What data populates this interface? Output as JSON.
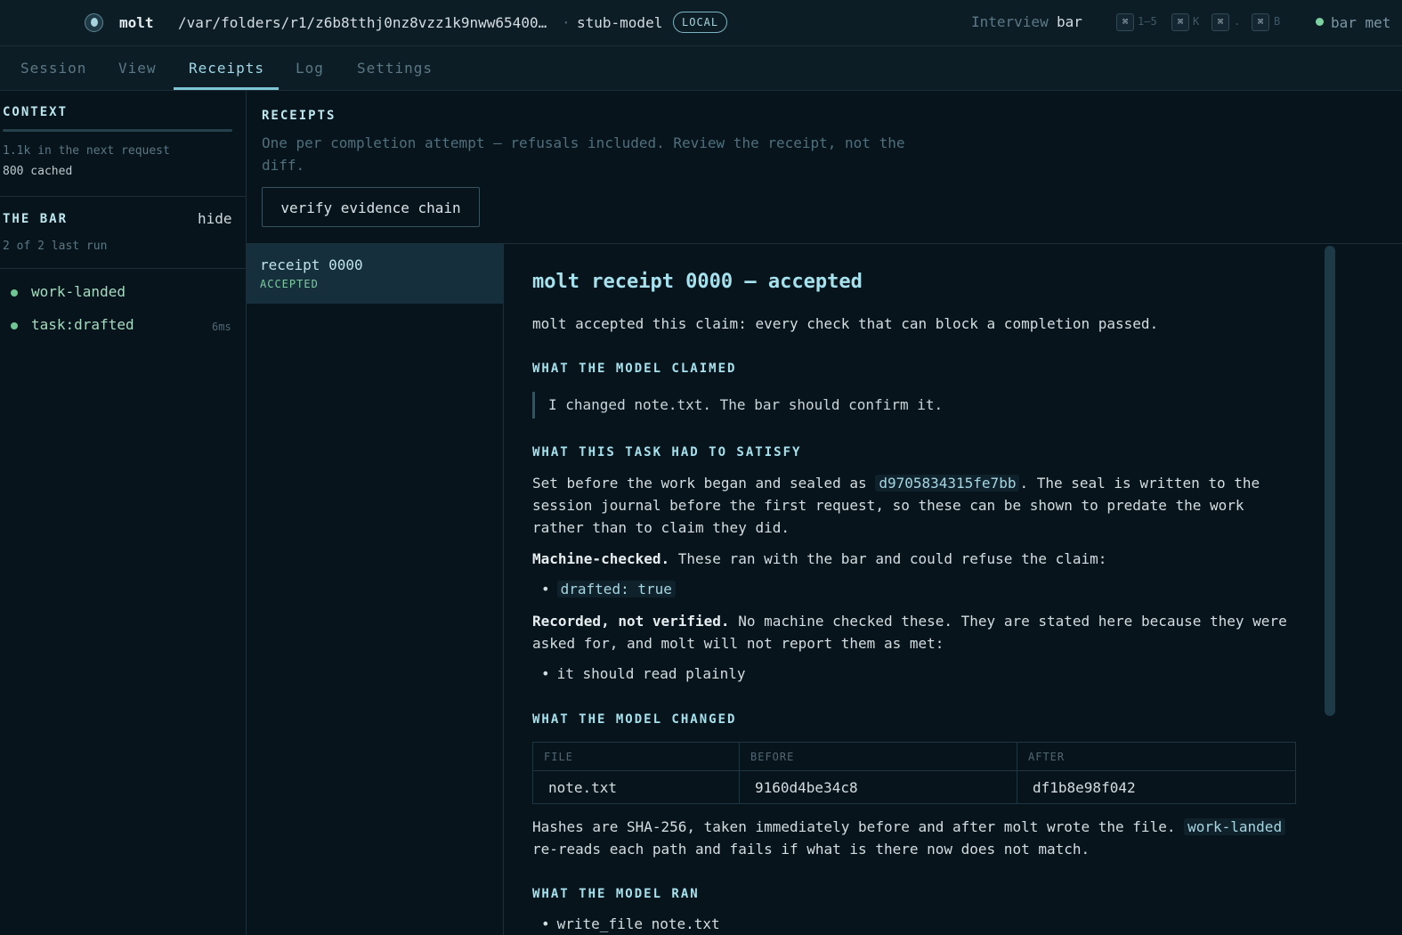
{
  "topbar": {
    "app_name": "molt",
    "path": "/var/folders/r1/z6b8tthj0nz8vzz1k9nww65400…",
    "separator": "·",
    "model": "stub-model",
    "badge": "LOCAL",
    "mode_label": "Interview",
    "mode_value": "bar",
    "shortcuts": [
      {
        "key": "⌘",
        "hint": "1–5"
      },
      {
        "key": "⌘",
        "hint": "K"
      },
      {
        "key": "⌘",
        "hint": "."
      },
      {
        "key": "⌘",
        "hint": "B"
      }
    ],
    "status_text": "bar met"
  },
  "tabs": [
    "Session",
    "View",
    "Receipts",
    "Log",
    "Settings"
  ],
  "active_tab": "Receipts",
  "sidebar": {
    "context": {
      "heading": "CONTEXT",
      "next_request": "1.1k in the next request",
      "cached": "800 cached"
    },
    "bar": {
      "heading": "THE BAR",
      "hide_label": "hide",
      "subtitle": "2 of 2 last run",
      "checks": [
        {
          "name": "work-landed",
          "time": ""
        },
        {
          "name": "task:drafted",
          "time": "6ms"
        }
      ]
    }
  },
  "receipts": {
    "heading": "RECEIPTS",
    "description": "One per completion attempt — refusals included. Review the receipt, not the diff.",
    "verify_button": "verify evidence chain",
    "list": [
      {
        "title": "receipt 0000",
        "status": "ACCEPTED"
      }
    ]
  },
  "detail": {
    "title": "molt receipt 0000 — accepted",
    "summary": "molt accepted this claim: every check that can block a completion passed.",
    "claimed_heading": "WHAT THE MODEL CLAIMED",
    "claim": "I changed note.txt. The bar should confirm it.",
    "satisfy_heading": "WHAT THIS TASK HAD TO SATISFY",
    "seal_pre": "Set before the work began and sealed as",
    "seal_hash": "d9705834315fe7bb",
    "seal_post": ". The seal is written to the session journal before the first request, so these can be shown to predate the work rather than to claim they did.",
    "machine_bold": "Machine-checked.",
    "machine_text": " These ran with the bar and could refuse the claim:",
    "machine_items": [
      "drafted: true"
    ],
    "recorded_bold": "Recorded, not verified.",
    "recorded_text": " No machine checked these. They are stated here because they were asked for, and molt will not report them as met:",
    "recorded_items": [
      "it should read plainly"
    ],
    "changed_heading": "WHAT THE MODEL CHANGED",
    "table": {
      "headers": [
        "FILE",
        "BEFORE",
        "AFTER"
      ],
      "rows": [
        [
          "note.txt",
          "9160d4be34c8",
          "df1b8e98f042"
        ]
      ]
    },
    "hash_pre": "Hashes are SHA-256, taken immediately before and after molt wrote the file.",
    "hash_code": "work-landed",
    "hash_post": "re-reads each path and fails if what is there now does not match.",
    "ran_heading": "WHAT THE MODEL RAN",
    "ran_items": [
      "write_file note.txt"
    ]
  }
}
